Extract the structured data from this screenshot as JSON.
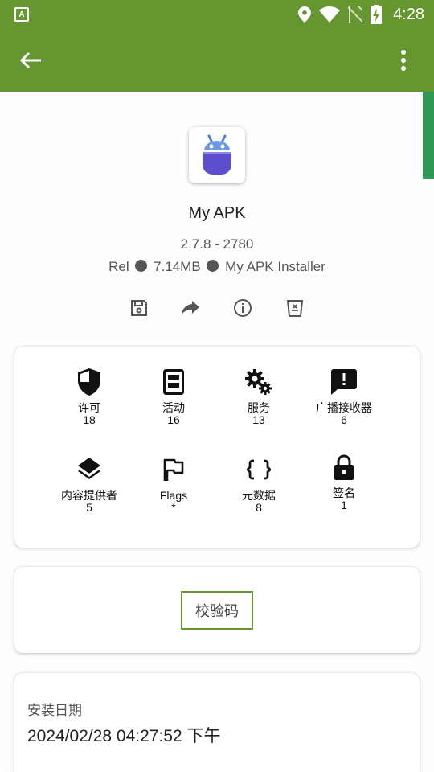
{
  "status_bar": {
    "time": "4:28",
    "notification_letter": "A"
  },
  "app": {
    "name": "My APK",
    "version": "2.7.8 - 2780",
    "meta_build": "Rel",
    "meta_size": "7.14MB",
    "meta_installer": "My APK Installer"
  },
  "components": [
    {
      "label": "许可",
      "count": "18",
      "icon": "shield-icon"
    },
    {
      "label": "活动",
      "count": "16",
      "icon": "activity-icon"
    },
    {
      "label": "服务",
      "count": "13",
      "icon": "gears-icon"
    },
    {
      "label": "广播接收器",
      "count": "6",
      "icon": "broadcast-icon"
    },
    {
      "label": "内容提供者",
      "count": "5",
      "icon": "layers-icon"
    },
    {
      "label": "Flags",
      "count": "*",
      "icon": "flag-icon"
    },
    {
      "label": "元数据",
      "count": "8",
      "icon": "braces-icon"
    },
    {
      "label": "签名",
      "count": "1",
      "icon": "lock-icon"
    }
  ],
  "checksum": {
    "label": "校验码"
  },
  "install": {
    "label": "安装日期",
    "value": "2024/02/28 04:27:52 下午"
  },
  "colors": {
    "accent": "#66962f",
    "indicator": "#2e9a55",
    "icon_purple": "#5b4fd0",
    "icon_blue": "#5a8ee0"
  }
}
